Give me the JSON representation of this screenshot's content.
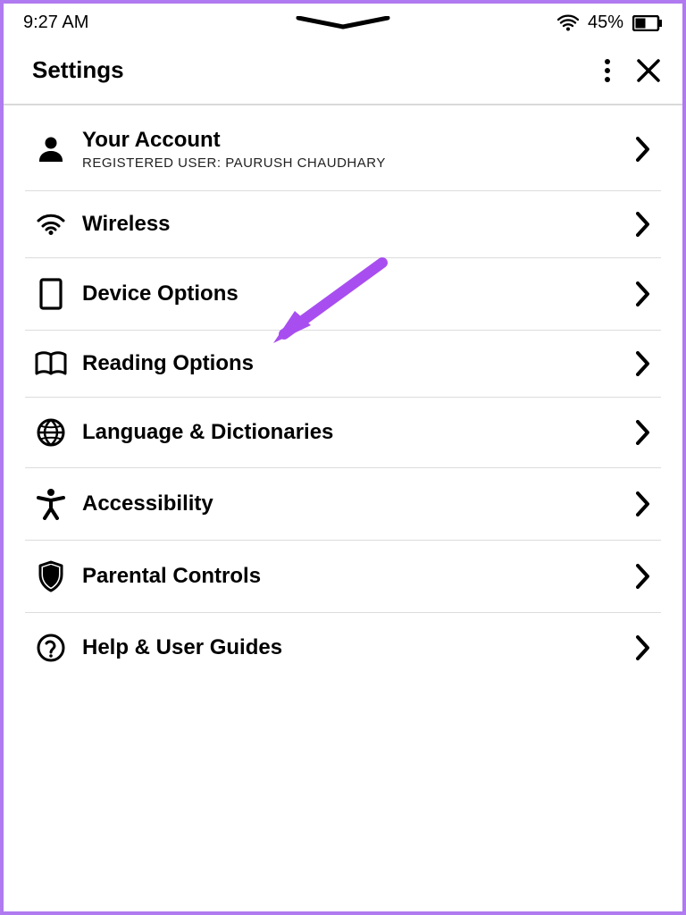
{
  "statusbar": {
    "time": "9:27 AM",
    "battery_percent": "45%"
  },
  "header": {
    "title": "Settings"
  },
  "rows": {
    "account": {
      "title": "Your Account",
      "subtitle": "REGISTERED USER: PAURUSH CHAUDHARY"
    },
    "wireless": {
      "title": "Wireless"
    },
    "device": {
      "title": "Device Options"
    },
    "reading": {
      "title": "Reading Options"
    },
    "language": {
      "title": "Language & Dictionaries"
    },
    "accessibility": {
      "title": "Accessibility"
    },
    "parental": {
      "title": "Parental Controls"
    },
    "help": {
      "title": "Help & User Guides"
    }
  }
}
